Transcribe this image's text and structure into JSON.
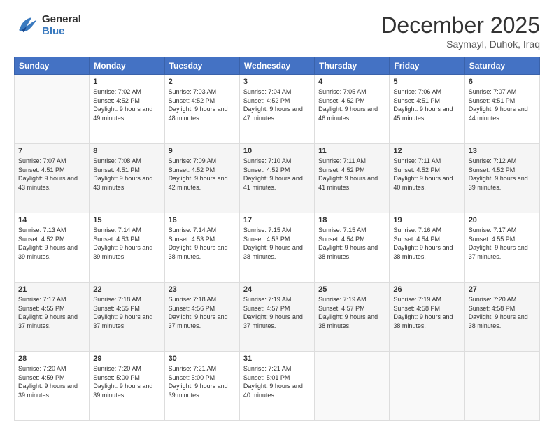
{
  "header": {
    "logo_general": "General",
    "logo_blue": "Blue",
    "month_year": "December 2025",
    "location": "Saymayl, Duhok, Iraq"
  },
  "days_of_week": [
    "Sunday",
    "Monday",
    "Tuesday",
    "Wednesday",
    "Thursday",
    "Friday",
    "Saturday"
  ],
  "weeks": [
    [
      {
        "day": "",
        "sunrise": "",
        "sunset": "",
        "daylight": "",
        "empty": true
      },
      {
        "day": "1",
        "sunrise": "Sunrise: 7:02 AM",
        "sunset": "Sunset: 4:52 PM",
        "daylight": "Daylight: 9 hours and 49 minutes."
      },
      {
        "day": "2",
        "sunrise": "Sunrise: 7:03 AM",
        "sunset": "Sunset: 4:52 PM",
        "daylight": "Daylight: 9 hours and 48 minutes."
      },
      {
        "day": "3",
        "sunrise": "Sunrise: 7:04 AM",
        "sunset": "Sunset: 4:52 PM",
        "daylight": "Daylight: 9 hours and 47 minutes."
      },
      {
        "day": "4",
        "sunrise": "Sunrise: 7:05 AM",
        "sunset": "Sunset: 4:52 PM",
        "daylight": "Daylight: 9 hours and 46 minutes."
      },
      {
        "day": "5",
        "sunrise": "Sunrise: 7:06 AM",
        "sunset": "Sunset: 4:51 PM",
        "daylight": "Daylight: 9 hours and 45 minutes."
      },
      {
        "day": "6",
        "sunrise": "Sunrise: 7:07 AM",
        "sunset": "Sunset: 4:51 PM",
        "daylight": "Daylight: 9 hours and 44 minutes."
      }
    ],
    [
      {
        "day": "7",
        "sunrise": "Sunrise: 7:07 AM",
        "sunset": "Sunset: 4:51 PM",
        "daylight": "Daylight: 9 hours and 43 minutes."
      },
      {
        "day": "8",
        "sunrise": "Sunrise: 7:08 AM",
        "sunset": "Sunset: 4:51 PM",
        "daylight": "Daylight: 9 hours and 43 minutes."
      },
      {
        "day": "9",
        "sunrise": "Sunrise: 7:09 AM",
        "sunset": "Sunset: 4:52 PM",
        "daylight": "Daylight: 9 hours and 42 minutes."
      },
      {
        "day": "10",
        "sunrise": "Sunrise: 7:10 AM",
        "sunset": "Sunset: 4:52 PM",
        "daylight": "Daylight: 9 hours and 41 minutes."
      },
      {
        "day": "11",
        "sunrise": "Sunrise: 7:11 AM",
        "sunset": "Sunset: 4:52 PM",
        "daylight": "Daylight: 9 hours and 41 minutes."
      },
      {
        "day": "12",
        "sunrise": "Sunrise: 7:11 AM",
        "sunset": "Sunset: 4:52 PM",
        "daylight": "Daylight: 9 hours and 40 minutes."
      },
      {
        "day": "13",
        "sunrise": "Sunrise: 7:12 AM",
        "sunset": "Sunset: 4:52 PM",
        "daylight": "Daylight: 9 hours and 39 minutes."
      }
    ],
    [
      {
        "day": "14",
        "sunrise": "Sunrise: 7:13 AM",
        "sunset": "Sunset: 4:52 PM",
        "daylight": "Daylight: 9 hours and 39 minutes."
      },
      {
        "day": "15",
        "sunrise": "Sunrise: 7:14 AM",
        "sunset": "Sunset: 4:53 PM",
        "daylight": "Daylight: 9 hours and 39 minutes."
      },
      {
        "day": "16",
        "sunrise": "Sunrise: 7:14 AM",
        "sunset": "Sunset: 4:53 PM",
        "daylight": "Daylight: 9 hours and 38 minutes."
      },
      {
        "day": "17",
        "sunrise": "Sunrise: 7:15 AM",
        "sunset": "Sunset: 4:53 PM",
        "daylight": "Daylight: 9 hours and 38 minutes."
      },
      {
        "day": "18",
        "sunrise": "Sunrise: 7:15 AM",
        "sunset": "Sunset: 4:54 PM",
        "daylight": "Daylight: 9 hours and 38 minutes."
      },
      {
        "day": "19",
        "sunrise": "Sunrise: 7:16 AM",
        "sunset": "Sunset: 4:54 PM",
        "daylight": "Daylight: 9 hours and 38 minutes."
      },
      {
        "day": "20",
        "sunrise": "Sunrise: 7:17 AM",
        "sunset": "Sunset: 4:55 PM",
        "daylight": "Daylight: 9 hours and 37 minutes."
      }
    ],
    [
      {
        "day": "21",
        "sunrise": "Sunrise: 7:17 AM",
        "sunset": "Sunset: 4:55 PM",
        "daylight": "Daylight: 9 hours and 37 minutes."
      },
      {
        "day": "22",
        "sunrise": "Sunrise: 7:18 AM",
        "sunset": "Sunset: 4:55 PM",
        "daylight": "Daylight: 9 hours and 37 minutes."
      },
      {
        "day": "23",
        "sunrise": "Sunrise: 7:18 AM",
        "sunset": "Sunset: 4:56 PM",
        "daylight": "Daylight: 9 hours and 37 minutes."
      },
      {
        "day": "24",
        "sunrise": "Sunrise: 7:19 AM",
        "sunset": "Sunset: 4:57 PM",
        "daylight": "Daylight: 9 hours and 37 minutes."
      },
      {
        "day": "25",
        "sunrise": "Sunrise: 7:19 AM",
        "sunset": "Sunset: 4:57 PM",
        "daylight": "Daylight: 9 hours and 38 minutes."
      },
      {
        "day": "26",
        "sunrise": "Sunrise: 7:19 AM",
        "sunset": "Sunset: 4:58 PM",
        "daylight": "Daylight: 9 hours and 38 minutes."
      },
      {
        "day": "27",
        "sunrise": "Sunrise: 7:20 AM",
        "sunset": "Sunset: 4:58 PM",
        "daylight": "Daylight: 9 hours and 38 minutes."
      }
    ],
    [
      {
        "day": "28",
        "sunrise": "Sunrise: 7:20 AM",
        "sunset": "Sunset: 4:59 PM",
        "daylight": "Daylight: 9 hours and 39 minutes."
      },
      {
        "day": "29",
        "sunrise": "Sunrise: 7:20 AM",
        "sunset": "Sunset: 5:00 PM",
        "daylight": "Daylight: 9 hours and 39 minutes."
      },
      {
        "day": "30",
        "sunrise": "Sunrise: 7:21 AM",
        "sunset": "Sunset: 5:00 PM",
        "daylight": "Daylight: 9 hours and 39 minutes."
      },
      {
        "day": "31",
        "sunrise": "Sunrise: 7:21 AM",
        "sunset": "Sunset: 5:01 PM",
        "daylight": "Daylight: 9 hours and 40 minutes."
      },
      {
        "day": "",
        "sunrise": "",
        "sunset": "",
        "daylight": "",
        "empty": true
      },
      {
        "day": "",
        "sunrise": "",
        "sunset": "",
        "daylight": "",
        "empty": true
      },
      {
        "day": "",
        "sunrise": "",
        "sunset": "",
        "daylight": "",
        "empty": true
      }
    ]
  ]
}
